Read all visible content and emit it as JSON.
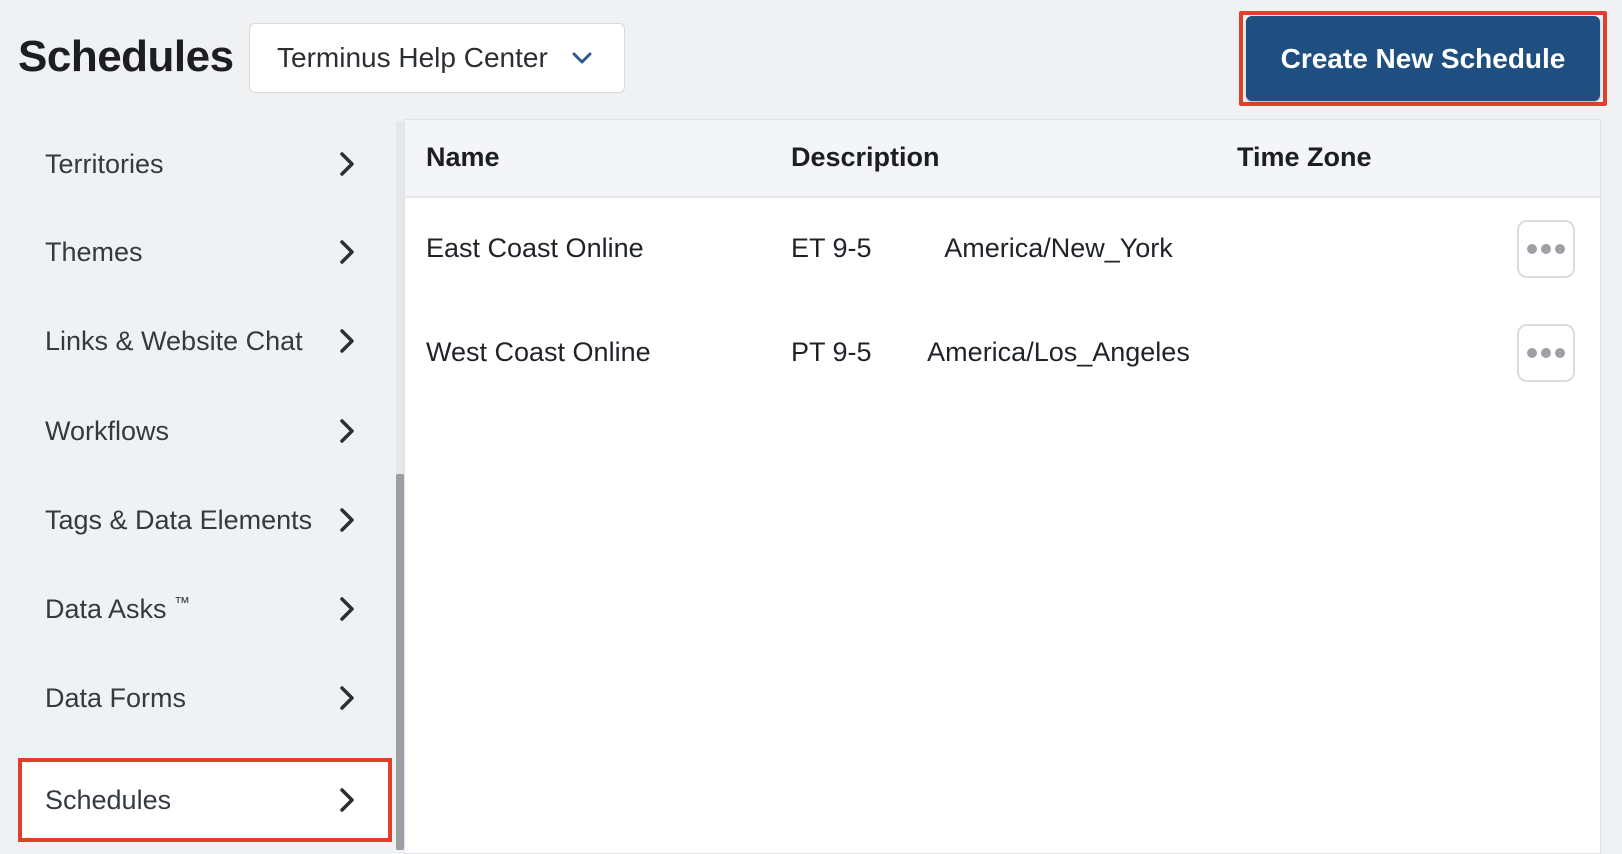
{
  "header": {
    "title": "Schedules",
    "account_selector": "Terminus Help Center",
    "create_button": "Create New Schedule"
  },
  "colors": {
    "primary": "#1e4f80",
    "highlight": "#e03f2a"
  },
  "sidebar": {
    "items": [
      {
        "label": "Territories",
        "active": false
      },
      {
        "label": "Themes",
        "active": false
      },
      {
        "label": "Links & Website Chat",
        "active": false
      },
      {
        "label": "Workflows",
        "active": false
      },
      {
        "label": "Tags & Data Elements",
        "active": false
      },
      {
        "label": "Data Asks",
        "trademark": "™",
        "active": false
      },
      {
        "label": "Data Forms",
        "active": false
      },
      {
        "label": "Schedules",
        "active": true
      }
    ]
  },
  "table": {
    "headers": {
      "name": "Name",
      "description": "Description",
      "time_zone": "Time Zone"
    },
    "rows": [
      {
        "name": "East Coast Online",
        "description": "ET 9-5",
        "time_zone": "America/New_York"
      },
      {
        "name": "West Coast Online",
        "description": "PT 9-5",
        "time_zone": "America/Los_Angeles"
      }
    ]
  }
}
